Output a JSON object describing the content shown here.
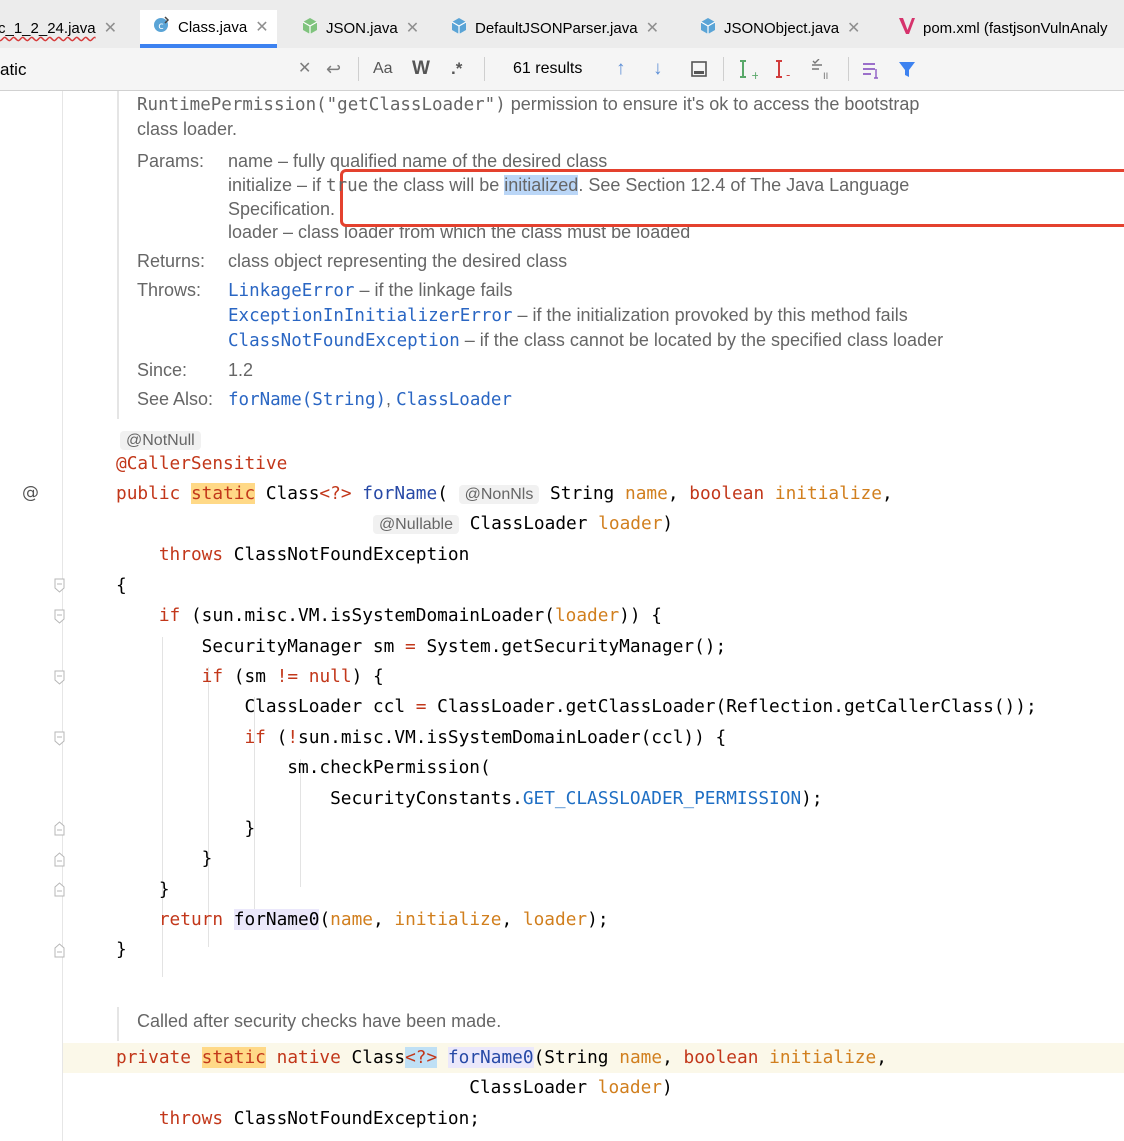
{
  "tabs": [
    {
      "label": "c_1_2_24.java",
      "icon": "java-file-icon"
    },
    {
      "label": "Class.java",
      "icon": "class-file-icon",
      "active": true
    },
    {
      "label": "JSON.java",
      "icon": "java-class-icon"
    },
    {
      "label": "DefaultJSONParser.java",
      "icon": "java-class-icon"
    },
    {
      "label": "JSONObject.java",
      "icon": "java-class-icon"
    },
    {
      "label": "pom.xml (fastjsonVulnAnaly",
      "icon": "maven-icon"
    }
  ],
  "find": {
    "query": "atic",
    "match_case": "Aa",
    "words": "W",
    "regex": ".*",
    "results": "61 results"
  },
  "doc": {
    "line1_a": "RuntimePermission(\"getClassLoader\")",
    "line1_b": " permission to ensure it's ok to access the bootstrap",
    "line2": "class loader.",
    "params_label": "Params:",
    "param_name": "name – fully qualified name of the desired class",
    "param_init_a": "initialize – if ",
    "param_init_true": "true",
    "param_init_b": " the class will be ",
    "param_init_hl": "initialized",
    "param_init_c": ". See Section 12.4 of The Java Language",
    "param_init_d": "Specification.",
    "param_loader": "loader – class loader from which the class must be loaded",
    "returns_label": "Returns:",
    "returns_text": "class object representing the desired class",
    "throws_label": "Throws:",
    "throws": [
      {
        "exc": "LinkageError",
        "text": " – if the linkage fails"
      },
      {
        "exc": "ExceptionInInitializerError",
        "text": " – if the initialization provoked by this method fails"
      },
      {
        "exc": "ClassNotFoundException",
        "text": " – if the class cannot be located by the specified class loader"
      }
    ],
    "since_label": "Since:",
    "since_text": "1.2",
    "seealso_label": "See Also:",
    "seealso_1": "forName(String)",
    "seealso_sep": ", ",
    "seealso_2": "ClassLoader"
  },
  "code": {
    "notnull": "@NotNull",
    "caller": "@CallerSensitive",
    "nonnls": "@NonNls",
    "nullable": "@Nullable"
  },
  "doc2": {
    "text": "Called after security checks have been made."
  },
  "gutter": {
    "at": "@"
  }
}
